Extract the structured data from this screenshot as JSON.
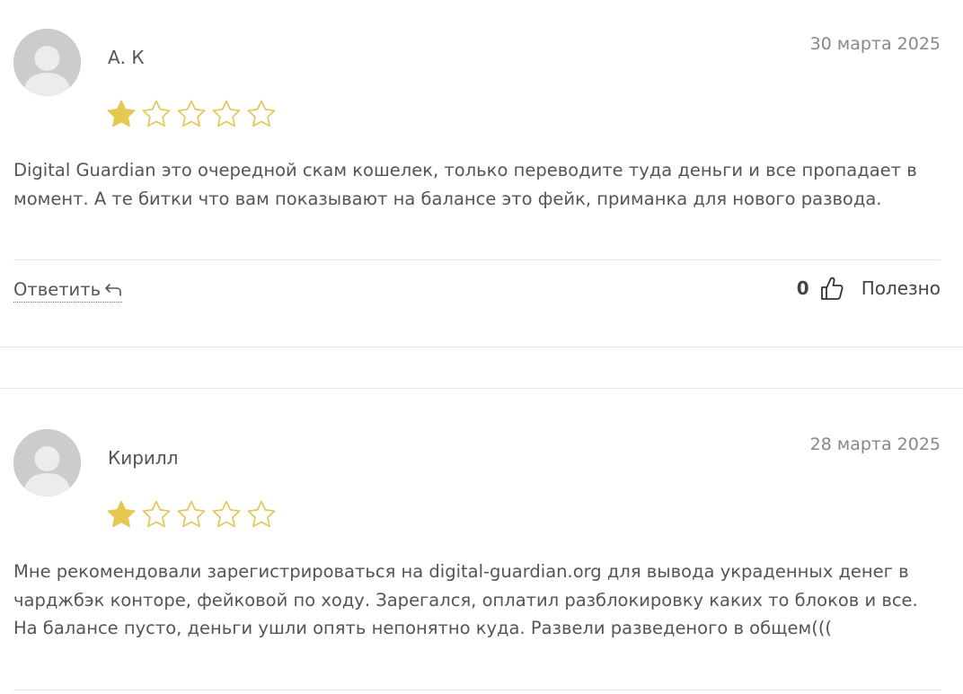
{
  "reviews": [
    {
      "author": "А. К",
      "date": "30 марта 2025",
      "rating": 1,
      "max_rating": 5,
      "text": "Digital Guardian это очередной скам кошелек, только переводите туда деньги и все пропадает в момент. А те битки что вам показывают на балансе это фейк, приманка для нового развода.",
      "reply_label": "Ответить",
      "likes": "0",
      "helpful_label": "Полезно"
    },
    {
      "author": "Кирилл",
      "date": "28 марта 2025",
      "rating": 1,
      "max_rating": 5,
      "text": "Мне рекомендовали зарегистрироваться на digital-guardian.org для вывода украденных денег в чарджбэк конторе, фейковой по ходу. Зарегался, оплатил разблокировку каких то блоков и все. На балансе пусто, деньги ушли опять непонятно куда. Развели разведеного в общем((("
    }
  ],
  "colors": {
    "star_filled": "#e8c84a",
    "star_empty_outline": "#e3c75a",
    "avatar_bg": "#c8c8c8",
    "avatar_figure": "#ececec",
    "divider": "#e4e4e4"
  },
  "icons": {
    "avatar": "user-placeholder-icon",
    "star": "star-icon",
    "reply": "reply-arrow-icon",
    "like": "thumbs-up-icon"
  }
}
